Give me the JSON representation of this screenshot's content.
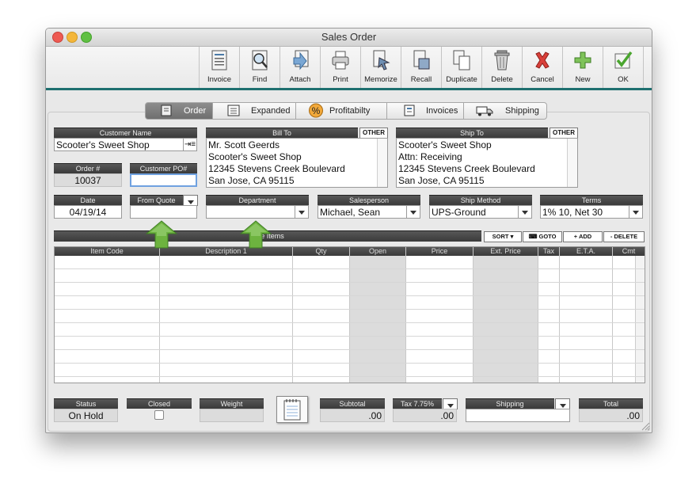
{
  "window": {
    "title": "Sales Order"
  },
  "colors": {
    "teal_bar": "#1e6f6f",
    "header_bar": "#444444",
    "field_gray": "#dcdcdc",
    "arrow_green": "#6db33f"
  },
  "toolbar": {
    "buttons": [
      {
        "label": "Invoice",
        "icon": "invoice-icon"
      },
      {
        "label": "Find",
        "icon": "find-icon"
      },
      {
        "label": "Attach",
        "icon": "attach-icon"
      },
      {
        "label": "Print",
        "icon": "print-icon"
      },
      {
        "label": "Memorize",
        "icon": "memorize-icon"
      },
      {
        "label": "Recall",
        "icon": "recall-icon"
      },
      {
        "label": "Duplicate",
        "icon": "duplicate-icon"
      },
      {
        "label": "Delete",
        "icon": "trash-icon"
      },
      {
        "label": "Cancel",
        "icon": "cancel-x-icon"
      },
      {
        "label": "New",
        "icon": "plus-icon"
      },
      {
        "label": "OK",
        "icon": "checkmark-icon"
      }
    ]
  },
  "tabs": [
    {
      "label": "Order",
      "icon": "order-icon",
      "selected": true
    },
    {
      "label": "Expanded",
      "icon": "expanded-icon"
    },
    {
      "label": "Profitabilty",
      "icon": "percent-icon"
    },
    {
      "label": "Invoices",
      "icon": "invoices-icon"
    },
    {
      "label": "Shipping",
      "icon": "truck-icon"
    }
  ],
  "customer": {
    "header": "Customer Name",
    "value": "Scooter's Sweet Shop"
  },
  "order": {
    "header": "Order #",
    "value": "10037"
  },
  "customer_po": {
    "header": "Customer PO#",
    "value": ""
  },
  "bill_to": {
    "header": "Bill To",
    "other": "OTHER",
    "lines": [
      "Mr. Scott Geerds",
      "Scooter's Sweet Shop",
      "12345 Stevens Creek Boulevard",
      "San Jose, CA  95115"
    ]
  },
  "ship_to": {
    "header": "Ship To",
    "other": "OTHER",
    "lines": [
      "Scooter's Sweet Shop",
      "Attn:  Receiving",
      "12345 Stevens Creek Boulevard",
      "San Jose, CA  95115"
    ]
  },
  "date": {
    "header": "Date",
    "value": "04/19/14"
  },
  "from_quote": {
    "header": "From Quote",
    "value": ""
  },
  "department": {
    "header": "Department",
    "value": ""
  },
  "salesperson": {
    "header": "Salesperson",
    "value": "Michael, Sean"
  },
  "ship_method": {
    "header": "Ship Method",
    "value": "UPS-Ground"
  },
  "terms": {
    "header": "Terms",
    "value": "1% 10, Net 30"
  },
  "line_items": {
    "header": "Line Items",
    "buttons": {
      "sort": "SORT",
      "goto": "GOTO",
      "add": "+ ADD",
      "delete": "- DELETE"
    },
    "columns": [
      "Item Code",
      "Description 1",
      "Qty",
      "Open",
      "Price",
      "Ext. Price",
      "Tax",
      "E.T.A.",
      "Cmt"
    ]
  },
  "footer": {
    "status": {
      "header": "Status",
      "value": "On Hold"
    },
    "closed": {
      "header": "Closed"
    },
    "weight": {
      "header": "Weight",
      "value": ""
    },
    "subtotal": {
      "header": "Subtotal",
      "value": ".00"
    },
    "tax": {
      "header": "Tax 7.75%",
      "value": ".00"
    },
    "shipping": {
      "header": "Shipping",
      "value": ""
    },
    "total": {
      "header": "Total",
      "value": ".00"
    }
  }
}
